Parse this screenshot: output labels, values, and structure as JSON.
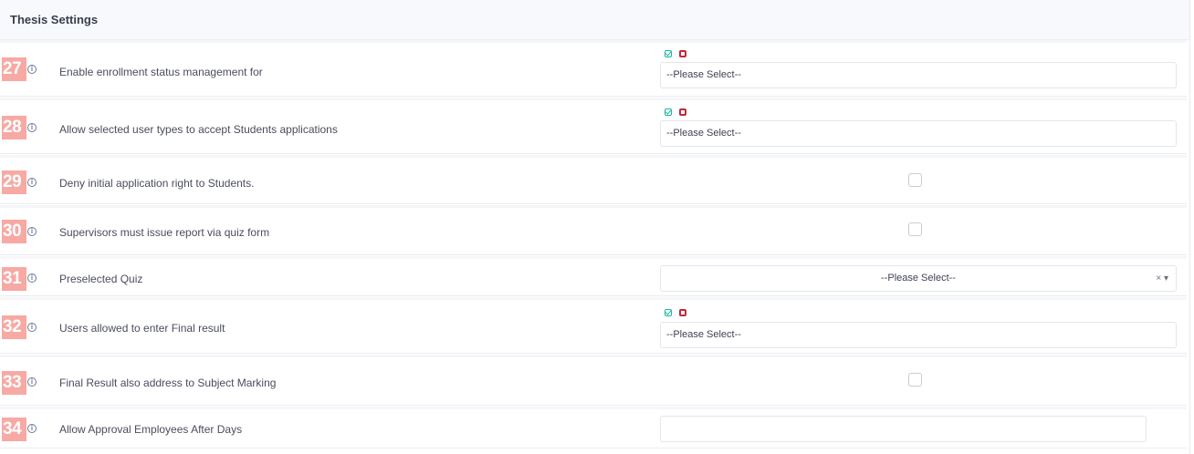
{
  "header": {
    "title": "Thesis Settings"
  },
  "rows": [
    {
      "num": "27",
      "label": "Enable enrollment status management for",
      "placeholder": "--Please Select--"
    },
    {
      "num": "28",
      "label": "Allow selected user types to accept Students applications",
      "placeholder": "--Please Select--"
    },
    {
      "num": "29",
      "label": "Deny initial application right to Students."
    },
    {
      "num": "30",
      "label": "Supervisors must issue report via quiz form"
    },
    {
      "num": "31",
      "label": "Preselected Quiz",
      "placeholder": "--Please Select--",
      "clear_symbol": "×",
      "arrow_symbol": "▾"
    },
    {
      "num": "32",
      "label": "Users allowed to enter Final result",
      "placeholder": "--Please Select--"
    },
    {
      "num": "33",
      "label": "Final Result also address to Subject Marking"
    },
    {
      "num": "34",
      "label": "Allow Approval Employees After Days"
    }
  ],
  "icons": {
    "info": "info-icon",
    "check_all": "check-square-icon",
    "uncheck_all": "square-icon"
  },
  "colors": {
    "number_badge": "#f7a9a4",
    "check_icon": "#1bb59a",
    "uncheck_icon": "#c0293b",
    "header_bg": "#f7f9fc"
  }
}
